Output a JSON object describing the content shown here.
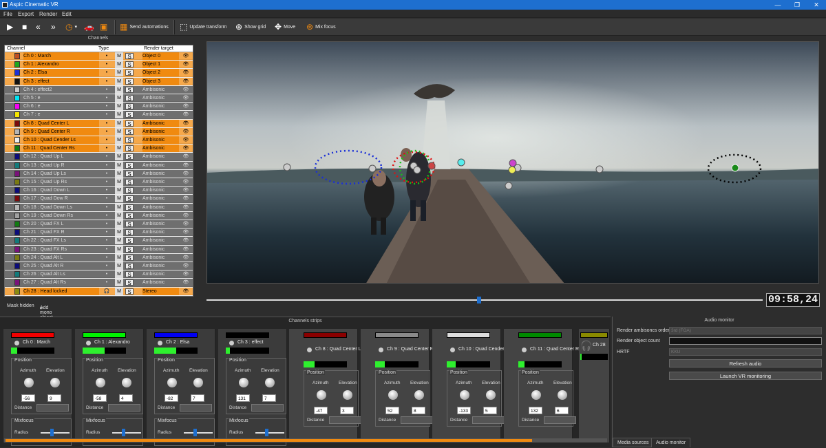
{
  "window": {
    "title": "Aspic Cinematic VR",
    "controls": [
      "—",
      "❐",
      "✕"
    ]
  },
  "menu": [
    "File",
    "Export",
    "Render",
    "Edit"
  ],
  "toolbar": {
    "send_automations": "Send automations",
    "update_transform": "Update transform",
    "show_grid": "Show grid",
    "move": "Move",
    "mix_focus": "Mix focus"
  },
  "channels": {
    "panel_title": "Channels",
    "headers": {
      "channel": "Channel",
      "type": "Type",
      "render": "Render target"
    },
    "rows": [
      {
        "name": "Ch 0 : March",
        "color": "#c04f20",
        "active": true,
        "m": "M",
        "s": "S",
        "render": "Object 0",
        "type": "•"
      },
      {
        "name": "Ch 1 : Alexandro",
        "color": "#1ea81e",
        "active": true,
        "m": "M",
        "s": "S",
        "render": "Object 1",
        "type": "•"
      },
      {
        "name": "Ch 2 : Elsa",
        "color": "#1a2fd6",
        "active": true,
        "m": "M",
        "s": "S",
        "render": "Object 2",
        "type": "•"
      },
      {
        "name": "Ch 3 : effect",
        "color": "#111111",
        "active": true,
        "m": "M",
        "s": "S",
        "render": "Object 3",
        "type": "•"
      },
      {
        "name": "Ch 4 : effect2",
        "color": "#cccccc",
        "active": false,
        "m": "M",
        "s": "S",
        "render": "Ambisonic",
        "type": "•"
      },
      {
        "name": "Ch 5 : e",
        "color": "#00e5f5",
        "active": false,
        "m": "M",
        "s": "S",
        "render": "Ambisonic",
        "type": "•"
      },
      {
        "name": "Ch 6 : e",
        "color": "#f500f5",
        "active": false,
        "m": "M",
        "s": "S",
        "render": "Ambisonic",
        "type": "•"
      },
      {
        "name": "Ch 7 : e",
        "color": "#f5e500",
        "active": false,
        "m": "M",
        "s": "S",
        "render": "Ambisonic",
        "type": "•"
      },
      {
        "name": "Ch 8 : Quad Center L",
        "color": "#7a0c0c",
        "active": true,
        "m": "M",
        "s": "S",
        "render": "Ambisonic",
        "type": "•"
      },
      {
        "name": "Ch 9 : Quad Center R",
        "color": "#b5b5b5",
        "active": true,
        "m": "M",
        "s": "S",
        "render": "Ambisonic",
        "type": "•"
      },
      {
        "name": "Ch 10 : Quad Cender Ls",
        "color": "#eeeeee",
        "active": true,
        "m": "M",
        "s": "S",
        "render": "Ambisonic",
        "type": "•"
      },
      {
        "name": "Ch 11 : Quad Center Rs",
        "color": "#117a11",
        "active": true,
        "m": "M",
        "s": "S",
        "render": "Ambisonic",
        "type": "•"
      },
      {
        "name": "Ch 12 : Quad Up L",
        "color": "#0c0c7a",
        "active": false,
        "m": "M",
        "s": "S",
        "render": "Ambisonic",
        "type": "•"
      },
      {
        "name": "Ch 13 : Quad Up R",
        "color": "#127a7a",
        "active": false,
        "m": "M",
        "s": "S",
        "render": "Ambisonic",
        "type": "•"
      },
      {
        "name": "Ch 14 : Quad Up Ls",
        "color": "#7a127a",
        "active": false,
        "m": "M",
        "s": "S",
        "render": "Ambisonic",
        "type": "•"
      },
      {
        "name": "Ch 15 : Quad Up Rs",
        "color": "#7a7a12",
        "active": false,
        "m": "M",
        "s": "S",
        "render": "Ambisonic",
        "type": "•"
      },
      {
        "name": "Ch 16 : Quad Down L",
        "color": "#0c0c7a",
        "active": false,
        "m": "M",
        "s": "S",
        "render": "Ambisonic",
        "type": "•"
      },
      {
        "name": "Ch 17 : Quad Dow R",
        "color": "#7a0c0c",
        "active": false,
        "m": "M",
        "s": "S",
        "render": "Ambisonic",
        "type": "•"
      },
      {
        "name": "Ch 18 : Quad Down Ls",
        "color": "#b5b5b5",
        "active": false,
        "m": "M",
        "s": "S",
        "render": "Ambisonic",
        "type": "•"
      },
      {
        "name": "Ch 19 : Quad Down Rs",
        "color": "#a0a0a0",
        "active": false,
        "m": "M",
        "s": "S",
        "render": "Ambisonic",
        "type": "•"
      },
      {
        "name": "Ch 20 : Quad FX L",
        "color": "#117a11",
        "active": false,
        "m": "M",
        "s": "S",
        "render": "Ambisonic",
        "type": "•"
      },
      {
        "name": "Ch 21 : Quad FX R",
        "color": "#0c0c7a",
        "active": false,
        "m": "M",
        "s": "S",
        "render": "Ambisonic",
        "type": "•"
      },
      {
        "name": "Ch 22 : Quad FX Ls",
        "color": "#127a7a",
        "active": false,
        "m": "M",
        "s": "S",
        "render": "Ambisonic",
        "type": "•"
      },
      {
        "name": "Ch 23 : Quad FX Rs",
        "color": "#7a127a",
        "active": false,
        "m": "M",
        "s": "S",
        "render": "Ambisonic",
        "type": "•"
      },
      {
        "name": "Ch 24 : Quad Alt L",
        "color": "#7a7a12",
        "active": false,
        "m": "M",
        "s": "S",
        "render": "Ambisonic",
        "type": "•"
      },
      {
        "name": "Ch 25 : Quad Alt R",
        "color": "#0c0c7a",
        "active": false,
        "m": "M",
        "s": "S",
        "render": "Ambisonic",
        "type": "•"
      },
      {
        "name": "Ch 26 : Quad Alt Ls",
        "color": "#127a7a",
        "active": false,
        "m": "M",
        "s": "S",
        "render": "Ambisonic",
        "type": "•"
      },
      {
        "name": "Ch 27 : Quad  Alt Rs",
        "color": "#7a127a",
        "active": false,
        "m": "M",
        "s": "S",
        "render": "Ambisonic",
        "type": "•"
      },
      {
        "name": "Ch 28 : Head locked",
        "color": "#8a8a10",
        "active": true,
        "m": "M",
        "s": "S",
        "render": "Stereo",
        "type": "🎧"
      }
    ],
    "mask_hidden": "Mask hidden",
    "add_mono": "Add mono object"
  },
  "timeline": {
    "timecode": "09:58,24",
    "position": 0.49
  },
  "strips": {
    "title": "Channels strips",
    "position_label": "Position",
    "azimuth_label": "Azimuth",
    "elevation_label": "Elevation",
    "distance_label": "Distance",
    "mixfocus_label": "Mixfocus",
    "radius_label": "Radius",
    "items": [
      {
        "name": "Ch 0 : March",
        "color": "#f20000",
        "azimuth": "-56",
        "elevation": "9",
        "level": 0.15,
        "mixfocus": true
      },
      {
        "name": "Ch 1 : Alexandro",
        "color": "#00f200",
        "azimuth": "-58",
        "elevation": "4",
        "level": 0.5,
        "mixfocus": true
      },
      {
        "name": "Ch 2 : Elsa",
        "color": "#0000f2",
        "azimuth": "-82",
        "elevation": "7",
        "level": 0.5,
        "mixfocus": true
      },
      {
        "name": "Ch 3 : effect",
        "color": "#000000",
        "azimuth": "131",
        "elevation": "7",
        "level": 0.1,
        "mixfocus": true
      },
      {
        "name": "Ch 8 : Quad Center L",
        "color": "#8a0000",
        "azimuth": "-47",
        "elevation": "3",
        "level": 0.25,
        "mixfocus": false
      },
      {
        "name": "Ch 9 : Quad Center R",
        "color": "#8a8a8a",
        "azimuth": "52",
        "elevation": "8",
        "level": 0.22,
        "mixfocus": false
      },
      {
        "name": "Ch 10 : Quad Cender Ls",
        "color": "#dddddd",
        "azimuth": "-133",
        "elevation": "5",
        "level": 0.2,
        "mixfocus": false
      },
      {
        "name": "Ch 11 : Quad Center Rs",
        "color": "#008a00",
        "azimuth": "132",
        "elevation": "6",
        "level": 0.15,
        "mixfocus": false
      },
      {
        "name": "Ch 28",
        "color": "#8a8a00",
        "azimuth": "",
        "elevation": "",
        "level": 0.05,
        "mixfocus": false
      }
    ]
  },
  "audio": {
    "title": "Audio monitor",
    "order_label": "Render ambisoncs order",
    "order_value": "3rd (FOA)",
    "count_label": "Render object count",
    "hrtf_label": "HRTF",
    "hrtf_value": "KKU",
    "refresh": "Refresh audio",
    "launch": "Launch VR monitoring",
    "tab_media": "Media sources",
    "tab_monitor": "Audio monitor"
  }
}
